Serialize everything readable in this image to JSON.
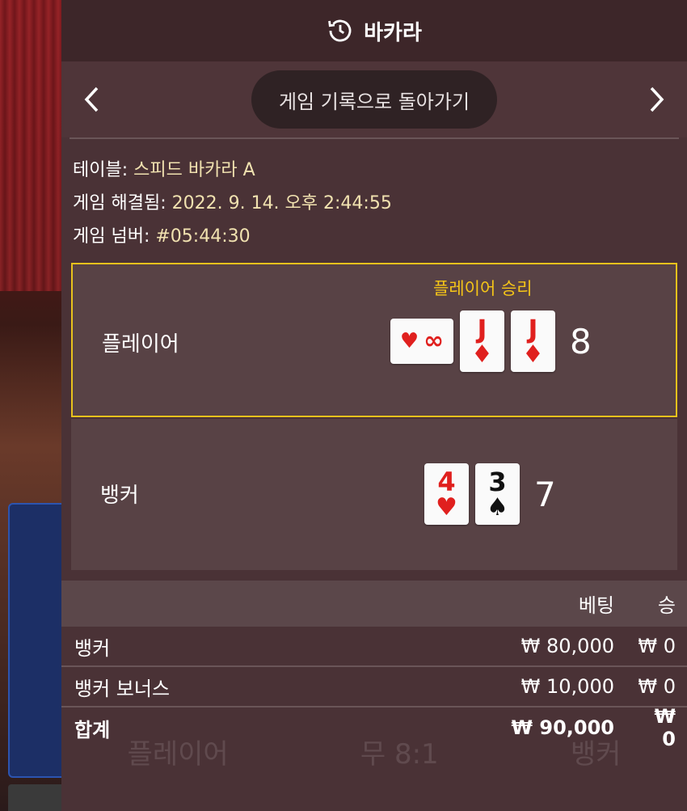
{
  "header": {
    "title": "바카라",
    "icon": "history-icon"
  },
  "nav": {
    "back_label": "게임 기록으로 돌아가기",
    "prev_icon": "chevron-left-icon",
    "next_icon": "chevron-right-icon"
  },
  "info": {
    "table_label": "테이블:",
    "table_value": "스피드 바카라 A",
    "resolved_label": "게임 해결됨:",
    "resolved_value": "2022. 9. 14. 오후 2:44:55",
    "number_label": "게임 넘버:",
    "number_value": "#05:44:30"
  },
  "player": {
    "label": "플레이어",
    "winner_text": "플레이어 승리",
    "score": "8",
    "cards": [
      {
        "rank": "∞",
        "suit": "♥",
        "color": "red"
      },
      {
        "rank": "J",
        "suit": "♦",
        "color": "red"
      },
      {
        "rank": "J",
        "suit": "♦",
        "color": "red"
      }
    ]
  },
  "banker": {
    "label": "뱅커",
    "score": "7",
    "cards": [
      {
        "rank": "4",
        "suit": "♥",
        "color": "red"
      },
      {
        "rank": "3",
        "suit": "♠",
        "color": "black"
      }
    ]
  },
  "bets": {
    "col_bet": "베팅",
    "col_win": "승",
    "rows": [
      {
        "name": "뱅커",
        "amount": "₩ 80,000",
        "win": "₩ 0"
      },
      {
        "name": "뱅커 보너스",
        "amount": "₩ 10,000",
        "win": "₩ 0"
      }
    ],
    "total": {
      "name": "합계",
      "amount": "₩ 90,000",
      "win": "₩ 0"
    }
  },
  "colors": {
    "highlight": "#e8c21c",
    "winner_text": "#f5c518",
    "card_red": "#e0201e"
  }
}
